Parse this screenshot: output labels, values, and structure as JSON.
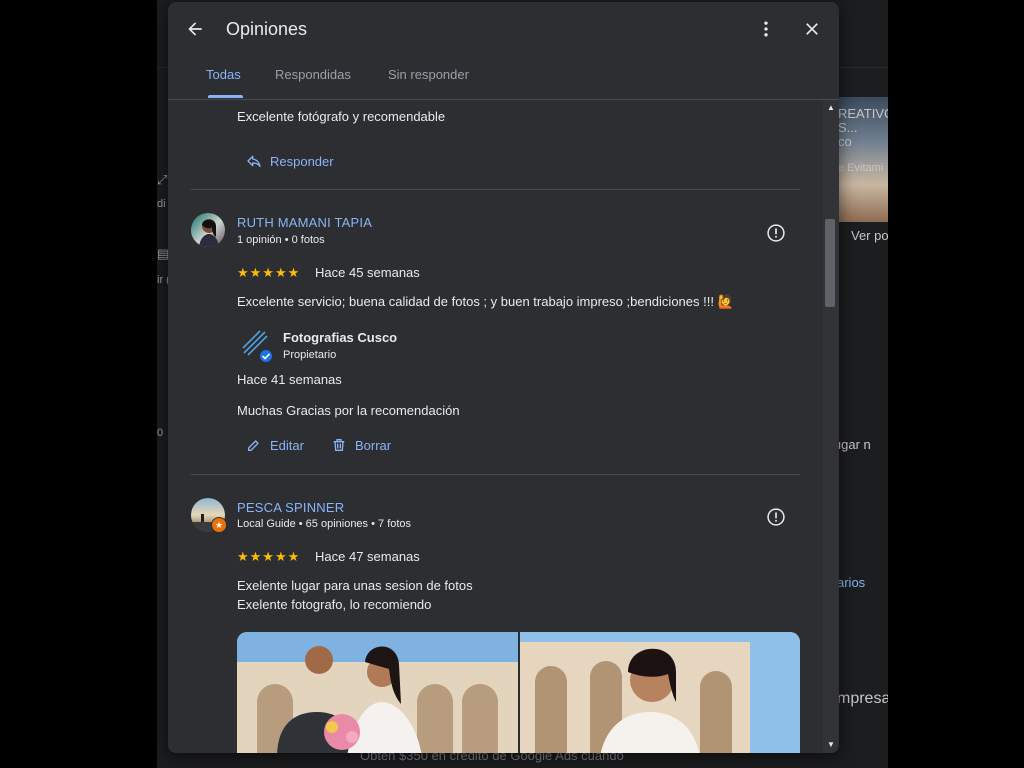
{
  "background": {
    "snippets": [
      "REATIVO",
      "S...",
      "co",
      "e Evitami",
      "Ver po",
      "lugar n",
      "arios",
      "mpresa",
      "Obtén $350 en crédito de Google Ads cuando",
      "di",
      "ir (",
      "0"
    ]
  },
  "dialog": {
    "title": "Opiniones",
    "tabs": [
      {
        "label": "Todas",
        "active": true
      },
      {
        "label": "Respondidas",
        "active": false
      },
      {
        "label": "Sin responder",
        "active": false
      }
    ]
  },
  "review_prev": {
    "text": "Excelente fotógrafo y recomendable",
    "reply_label": "Responder"
  },
  "review1": {
    "name": "RUTH MAMANI TAPIA",
    "meta": "1 opinión • 0 fotos",
    "stars": "★★★★★",
    "rating": 5,
    "time": "Hace 45 semanas",
    "text": "Excelente servicio; buena calidad de fotos ; y buen trabajo impreso ;bendiciones !!! 🙋",
    "owner_reply": {
      "name": "Fotografias Cusco",
      "role": "Propietario",
      "time": "Hace 41 semanas",
      "text": "Muchas Gracias por la recomendación",
      "edit_label": "Editar",
      "delete_label": "Borrar"
    }
  },
  "review2": {
    "name": "PESCA SPINNER",
    "meta": "Local Guide • 65 opiniones • 7 fotos",
    "stars": "★★★★★",
    "rating": 5,
    "time": "Hace 47 semanas",
    "text_line1": "Exelente lugar para unas sesion de fotos",
    "text_line2": "Exelente fotografo, lo recomiendo"
  },
  "colors": {
    "accent": "#8ab4f8",
    "star": "#fbbc04",
    "dialog_bg": "#2d2e31",
    "text": "#e8eaed"
  }
}
